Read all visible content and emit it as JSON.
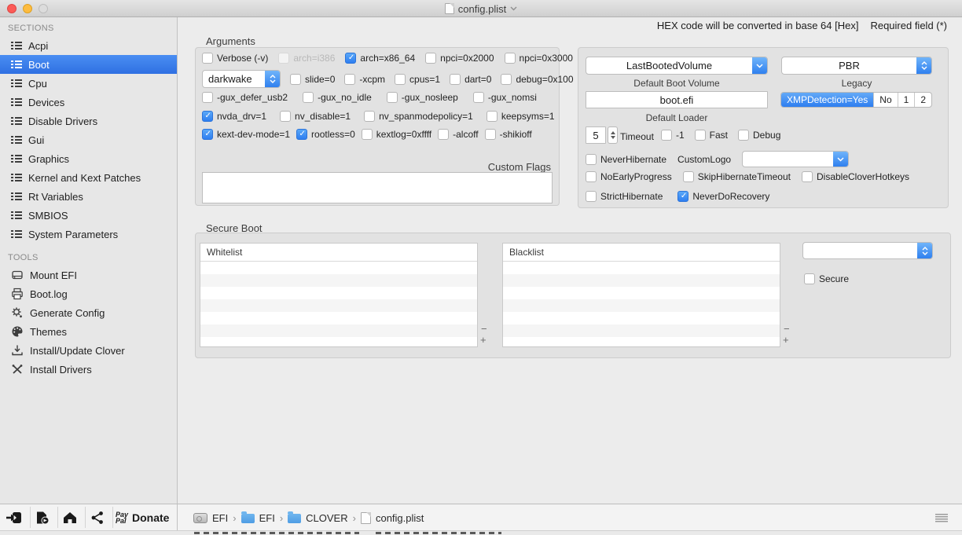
{
  "colors": {
    "accent_blue": "#2f80ef",
    "selection_blue": "#3b7ce4",
    "folder_blue": "#5fa9e6",
    "checkbox_blue": "#3b99fc"
  },
  "window": {
    "title": "config.plist"
  },
  "topnote": {
    "hex_note": "HEX code will be converted in base 64 [Hex]",
    "required_note": "Required field (*)"
  },
  "sidebar": {
    "sections_label": "SECTIONS",
    "sections": [
      {
        "label": "Acpi"
      },
      {
        "label": "Boot",
        "selected": true
      },
      {
        "label": "Cpu"
      },
      {
        "label": "Devices"
      },
      {
        "label": "Disable Drivers"
      },
      {
        "label": "Gui"
      },
      {
        "label": "Graphics"
      },
      {
        "label": "Kernel and Kext Patches"
      },
      {
        "label": "Rt Variables"
      },
      {
        "label": "SMBIOS"
      },
      {
        "label": "System Parameters"
      }
    ],
    "tools_label": "TOOLS",
    "tools": [
      {
        "label": "Mount EFI",
        "icon": "drive-icon"
      },
      {
        "label": "Boot.log",
        "icon": "printer-icon"
      },
      {
        "label": "Generate Config",
        "icon": "gear-icon"
      },
      {
        "label": "Themes",
        "icon": "palette-icon"
      },
      {
        "label": "Install/Update Clover",
        "icon": "download-icon"
      },
      {
        "label": "Install Drivers",
        "icon": "tools-icon"
      }
    ]
  },
  "arguments": {
    "label": "Arguments",
    "row1": [
      {
        "label": "Verbose (-v)",
        "checked": false
      },
      {
        "label": "arch=i386",
        "checked": false,
        "disabled": true
      },
      {
        "label": "arch=x86_64",
        "checked": true
      },
      {
        "label": "npci=0x2000",
        "checked": false
      },
      {
        "label": "npci=0x3000",
        "checked": false
      }
    ],
    "darkwake_value": "darkwake",
    "row2": [
      {
        "label": "slide=0",
        "checked": false
      },
      {
        "label": "-xcpm",
        "checked": false
      },
      {
        "label": "cpus=1",
        "checked": false
      },
      {
        "label": "dart=0",
        "checked": false
      },
      {
        "label": "debug=0x100",
        "checked": false
      }
    ],
    "row3": [
      {
        "label": "-gux_defer_usb2",
        "checked": false
      },
      {
        "label": "-gux_no_idle",
        "checked": false
      },
      {
        "label": "-gux_nosleep",
        "checked": false
      },
      {
        "label": "-gux_nomsi",
        "checked": false
      }
    ],
    "row4": [
      {
        "label": "nvda_drv=1",
        "checked": true
      },
      {
        "label": "nv_disable=1",
        "checked": false
      },
      {
        "label": "nv_spanmodepolicy=1",
        "checked": false
      },
      {
        "label": "keepsyms=1",
        "checked": false
      }
    ],
    "row5": [
      {
        "label": "kext-dev-mode=1",
        "checked": true
      },
      {
        "label": "rootless=0",
        "checked": true
      },
      {
        "label": "kextlog=0xffff",
        "checked": false
      },
      {
        "label": "-alcoff",
        "checked": false
      },
      {
        "label": "-shikioff",
        "checked": false
      }
    ],
    "custom_flags_label": "Custom Flags",
    "custom_flags_value": ""
  },
  "boot_options": {
    "default_boot_volume": {
      "value": "LastBootedVolume",
      "label": "Default Boot Volume"
    },
    "legacy": {
      "value": "PBR",
      "label": "Legacy"
    },
    "default_loader": {
      "value": "boot.efi",
      "label": "Default Loader"
    },
    "xmp": {
      "segments": [
        "XMPDetection=Yes",
        "No",
        "1",
        "2"
      ],
      "selected_index": 0
    },
    "timeout": {
      "value": "5",
      "label": "Timeout"
    },
    "timeout_checks": [
      {
        "label": "-1",
        "checked": false
      },
      {
        "label": "Fast",
        "checked": false
      },
      {
        "label": "Debug",
        "checked": false
      }
    ],
    "never_hibernate": {
      "label": "NeverHibernate",
      "checked": false
    },
    "custom_logo_label": "CustomLogo",
    "custom_logo_value": "",
    "row_progress": [
      {
        "label": "NoEarlyProgress",
        "checked": false
      },
      {
        "label": "SkipHibernateTimeout",
        "checked": false
      },
      {
        "label": "DisableCloverHotkeys",
        "checked": false
      }
    ],
    "row_strict": [
      {
        "label": "StrictHibernate",
        "checked": false
      },
      {
        "label": "NeverDoRecovery",
        "checked": true
      }
    ]
  },
  "secure_boot": {
    "label": "Secure Boot",
    "whitelist_header": "Whitelist",
    "blacklist_header": "Blacklist",
    "minus": "−",
    "plus": "+",
    "policy_value": "",
    "secure_label": "Secure"
  },
  "bottombar": {
    "paypal_line1": "Pay",
    "paypal_line2": "Pal",
    "donate_label": "Donate",
    "breadcrumb": [
      {
        "icon": "disk-icon",
        "label": "EFI"
      },
      {
        "icon": "folder-icon",
        "label": "EFI"
      },
      {
        "icon": "folder-icon",
        "label": "CLOVER"
      },
      {
        "icon": "file-icon",
        "label": "config.plist"
      }
    ],
    "separator": "›"
  }
}
